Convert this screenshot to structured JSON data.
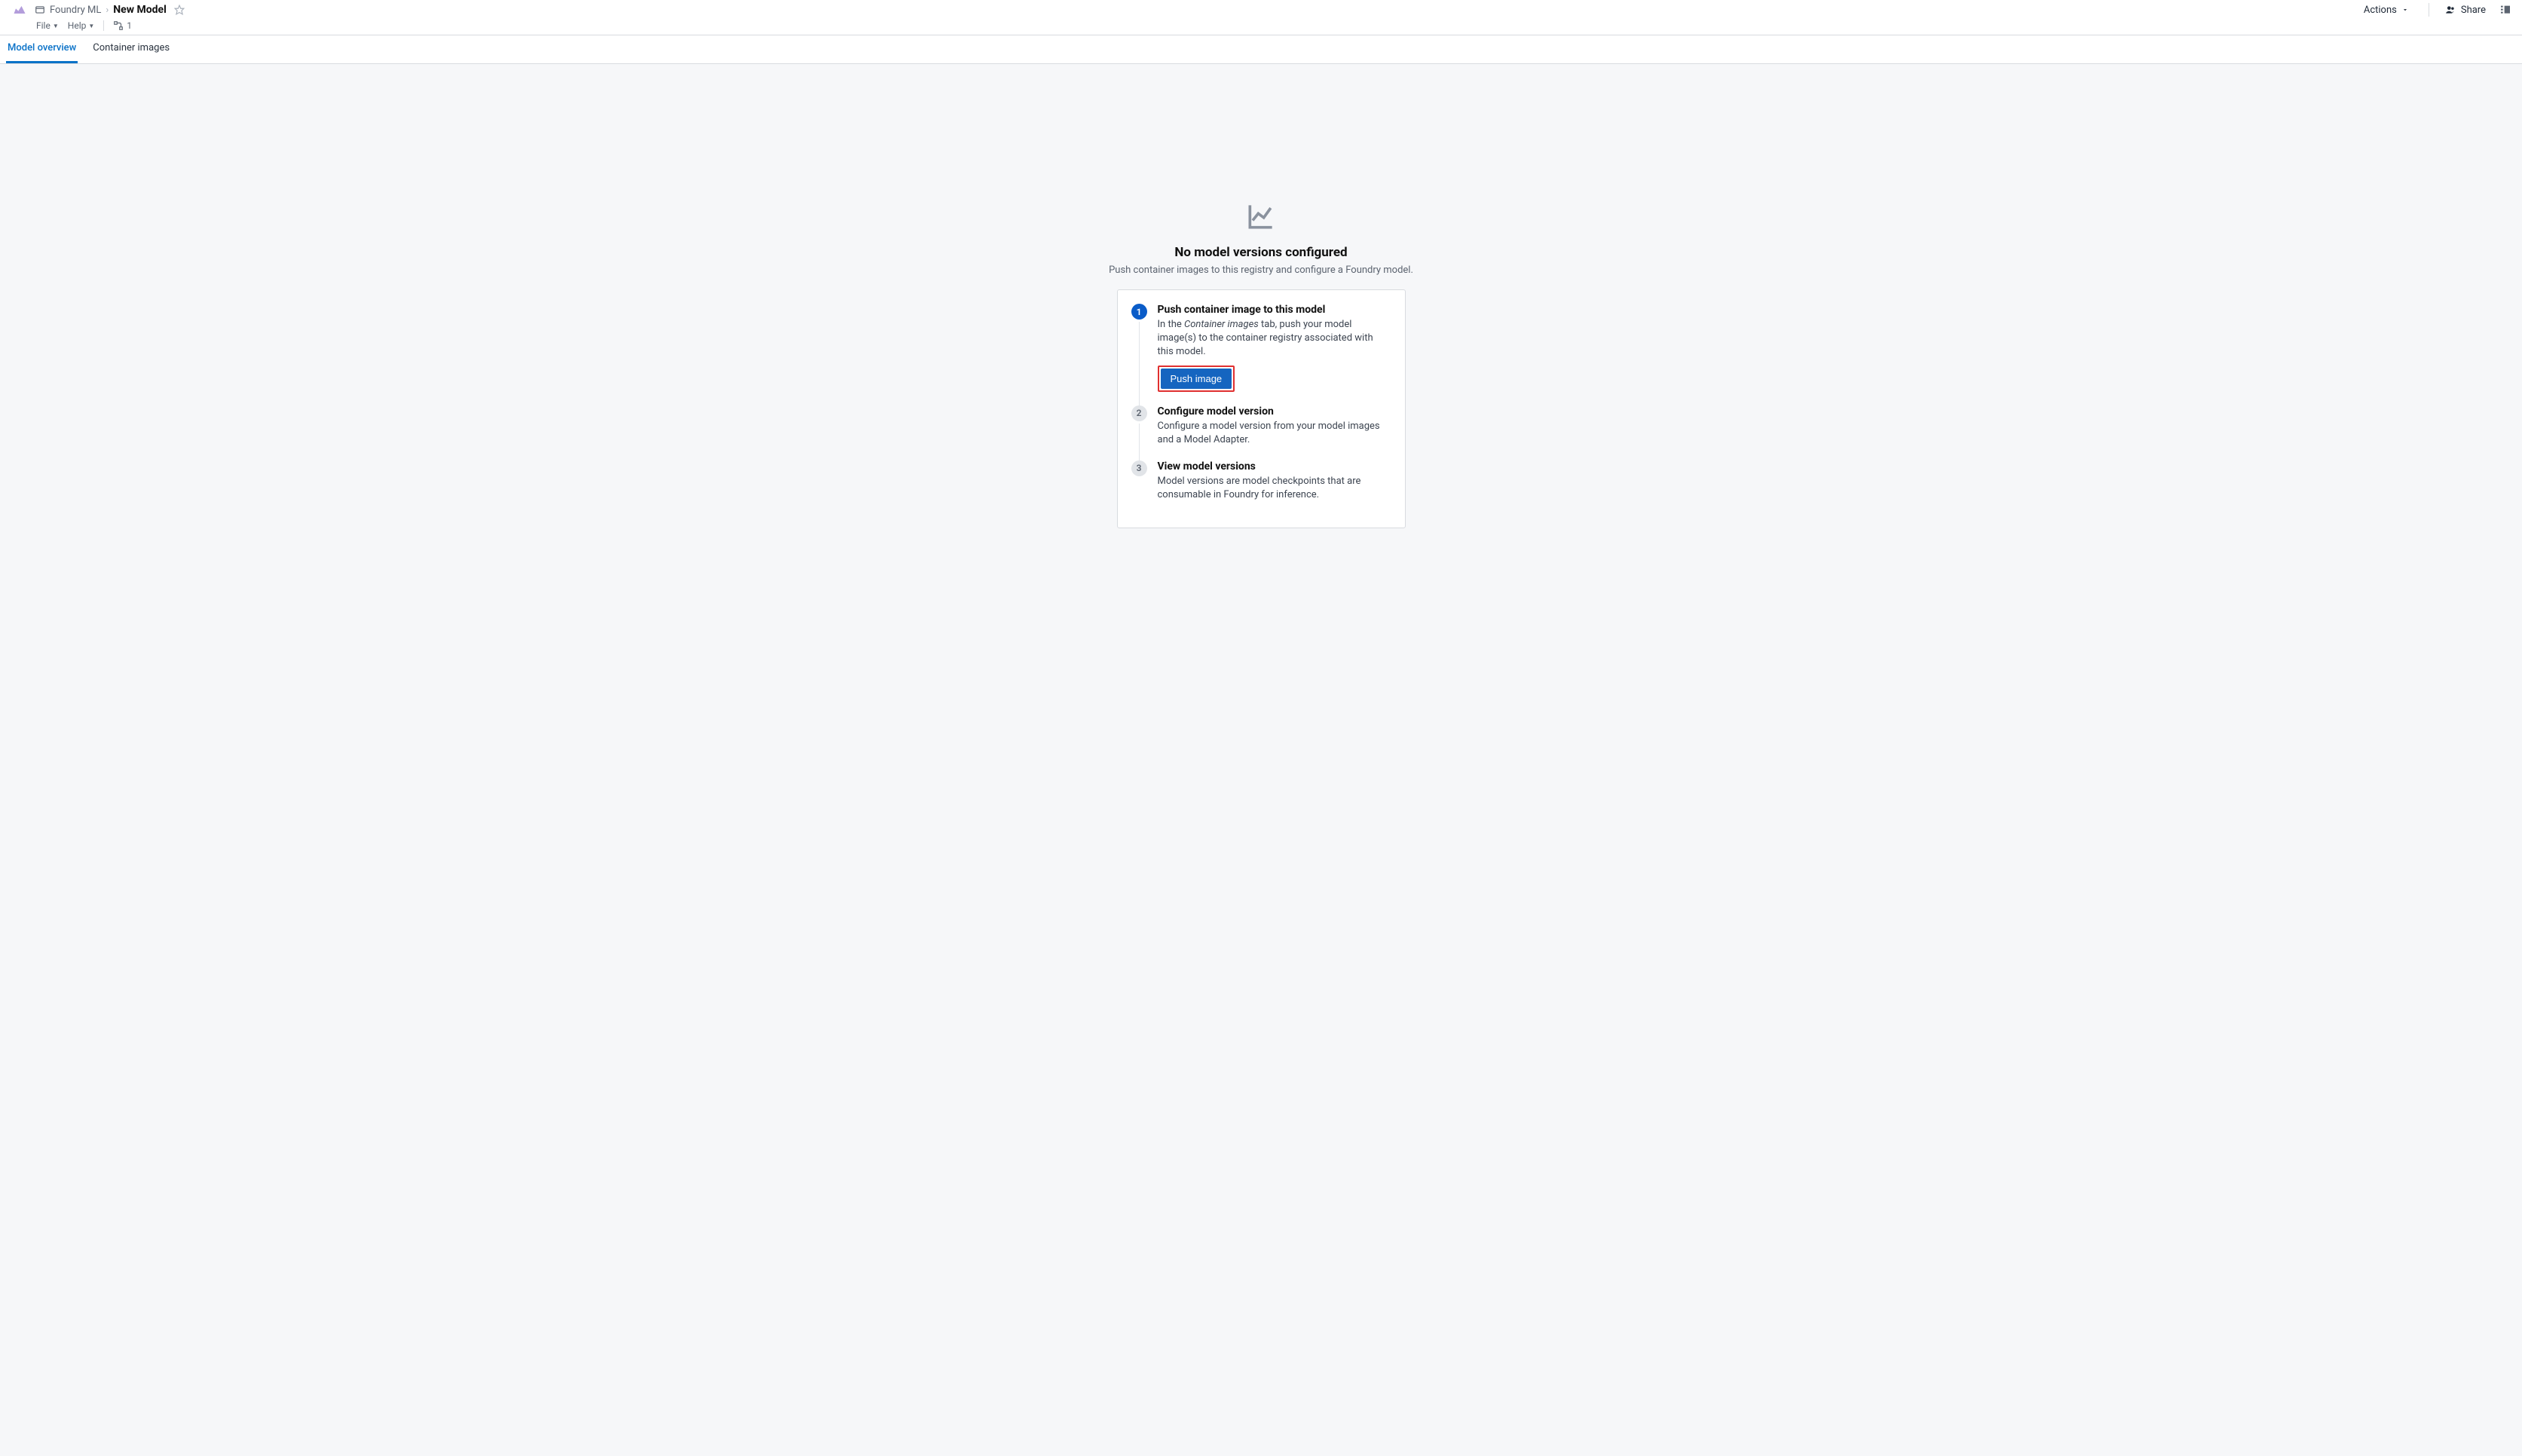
{
  "header": {
    "breadcrumb_parent": "Foundry ML",
    "breadcrumb_current": "New Model",
    "actions_label": "Actions",
    "share_label": "Share",
    "menu_file": "File",
    "menu_help": "Help",
    "graph_count": "1"
  },
  "tabs": [
    {
      "label": "Model overview",
      "active": true
    },
    {
      "label": "Container images",
      "active": false
    }
  ],
  "empty": {
    "title": "No model versions configured",
    "subtitle": "Push container images to this registry and configure a Foundry model."
  },
  "steps": [
    {
      "num": "1",
      "active": true,
      "title": "Push container image to this model",
      "desc_pre": "In the ",
      "desc_em": "Container images",
      "desc_post": " tab, push your model image(s) to the container registry associated with this model.",
      "button": "Push image"
    },
    {
      "num": "2",
      "active": false,
      "title": "Configure model version",
      "desc": "Configure a model version from your model images and a Model Adapter."
    },
    {
      "num": "3",
      "active": false,
      "title": "View model versions",
      "desc": "Model versions are model checkpoints that are consumable in Foundry for inference."
    }
  ]
}
